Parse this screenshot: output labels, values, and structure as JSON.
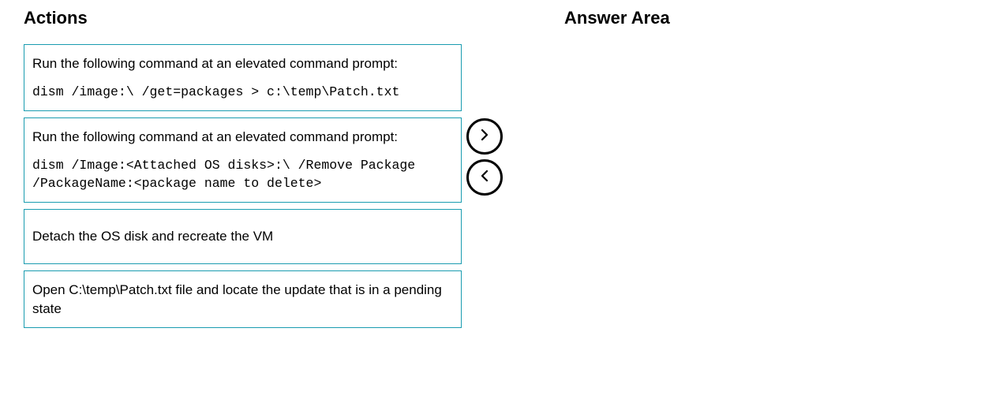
{
  "actions": {
    "heading": "Actions",
    "items": [
      {
        "lead": "Run the following command at an elevated command prompt:",
        "command": "dism /image:\\ /get=packages > c:\\temp\\Patch.txt"
      },
      {
        "lead": "Run the following command at an elevated command prompt:",
        "command": "dism /Image:<Attached OS disks>:\\ /Remove Package /PackageName:<package name to delete>"
      },
      {
        "text": "Detach the OS disk and recreate the VM"
      },
      {
        "text": "Open C:\\temp\\Patch.txt file and locate the update that is in a pending state"
      }
    ]
  },
  "answer_area": {
    "heading": "Answer Area"
  }
}
